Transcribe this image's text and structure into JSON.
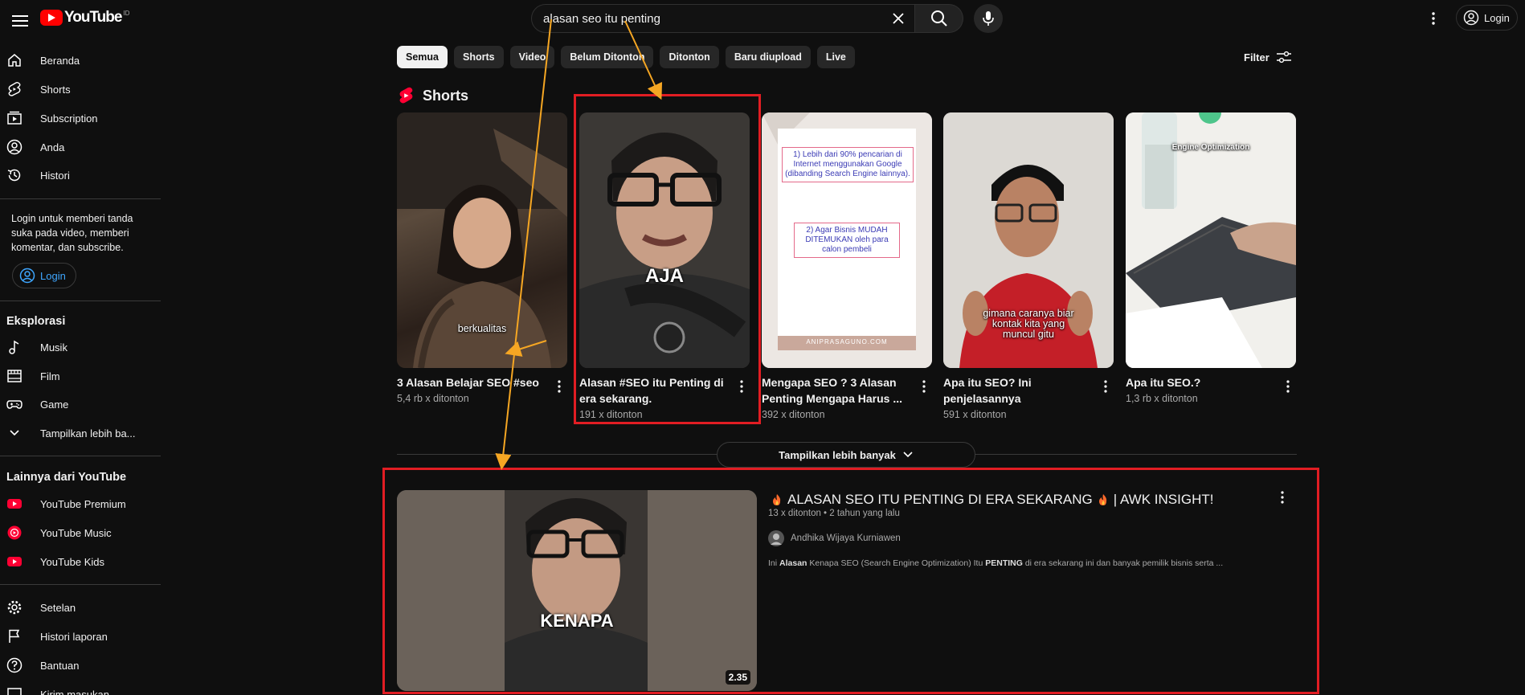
{
  "header": {
    "logo_text": "YouTube",
    "logo_country": "ID",
    "search_value": "alasan seo itu penting",
    "login_label": "Login"
  },
  "sidebar": {
    "main": [
      {
        "label": "Beranda",
        "icon": "home-icon"
      },
      {
        "label": "Shorts",
        "icon": "shorts-icon"
      },
      {
        "label": "Subscription",
        "icon": "subscription-icon"
      },
      {
        "label": "Anda",
        "icon": "account-icon"
      },
      {
        "label": "Histori",
        "icon": "history-icon"
      }
    ],
    "login_note": "Login untuk memberi tanda suka pada video, memberi komentar, dan subscribe.",
    "login_label": "Login",
    "explore_heading": "Eksplorasi",
    "explore": [
      {
        "label": "Musik",
        "icon": "music-icon"
      },
      {
        "label": "Film",
        "icon": "film-icon"
      },
      {
        "label": "Game",
        "icon": "game-icon"
      },
      {
        "label": "Tampilkan lebih ba...",
        "icon": "chevron-down-icon"
      }
    ],
    "more_heading": "Lainnya dari YouTube",
    "more": [
      {
        "label": "YouTube Premium",
        "icon": "youtube-premium-icon"
      },
      {
        "label": "YouTube Music",
        "icon": "youtube-music-icon"
      },
      {
        "label": "YouTube Kids",
        "icon": "youtube-kids-icon"
      }
    ],
    "settings": [
      {
        "label": "Setelan",
        "icon": "settings-icon"
      },
      {
        "label": "Histori laporan",
        "icon": "flag-icon"
      },
      {
        "label": "Bantuan",
        "icon": "help-icon"
      },
      {
        "label": "Kirim masukan",
        "icon": "feedback-icon"
      }
    ]
  },
  "chips": [
    "Semua",
    "Shorts",
    "Video",
    "Belum Ditonton",
    "Ditonton",
    "Baru diupload",
    "Live"
  ],
  "filter_label": "Filter",
  "shorts_heading": "Shorts",
  "shorts": [
    {
      "title": "3 Alasan Belajar SEO #seo",
      "views": "5,4 rb x ditonton",
      "caption": "berkualitas"
    },
    {
      "title": "Alasan #SEO itu Penting di era sekarang.",
      "views": "191 x ditonton",
      "caption": "AJA"
    },
    {
      "title": "Mengapa SEO ? 3 Alasan Penting Mengapa Harus ...",
      "views": "392 x ditonton",
      "caption": "",
      "card1": "1) Lebih dari 90% pencarian di Internet menggunakan Google (dibanding Search Engine lainnya).",
      "card2": "2) Agar Bisnis MUDAH DITEMUKAN oleh para calon pembeli",
      "watermark": "ANIPRASAGUNO.COM"
    },
    {
      "title": "Apa itu SEO? Ini penjelasannya",
      "views": "591 x ditonton",
      "caption": "gimana caranya biar kontak kita yang muncul gitu"
    },
    {
      "title": "Apa itu SEO.?",
      "views": "1,3 rb x ditonton",
      "caption": "Engine Optimization"
    }
  ],
  "expand_label": "Tampilkan lebih banyak",
  "video": {
    "title": "ALASAN SEO ITU PENTING DI ERA SEKARANG",
    "title_suffix": "| AWK INSIGHT!",
    "meta": "13 x ditonton • 2 tahun yang lalu",
    "channel": "Andhika Wijaya Kurniawen",
    "desc_pre": "Ini ",
    "desc_b1": "Alasan",
    "desc_mid": " Kenapa SEO (Search Engine Optimization) Itu ",
    "desc_b2": "PENTING",
    "desc_post": " di era sekarang ini dan banyak pemilik bisnis serta ...",
    "caption": "KENAPA",
    "duration": "2.35"
  },
  "colors": {
    "background": "#0f0f0f",
    "brand_red": "#ff0000",
    "highlight": "#e11d23",
    "arrow": "#f5a623",
    "link_blue": "#3ea6ff"
  }
}
